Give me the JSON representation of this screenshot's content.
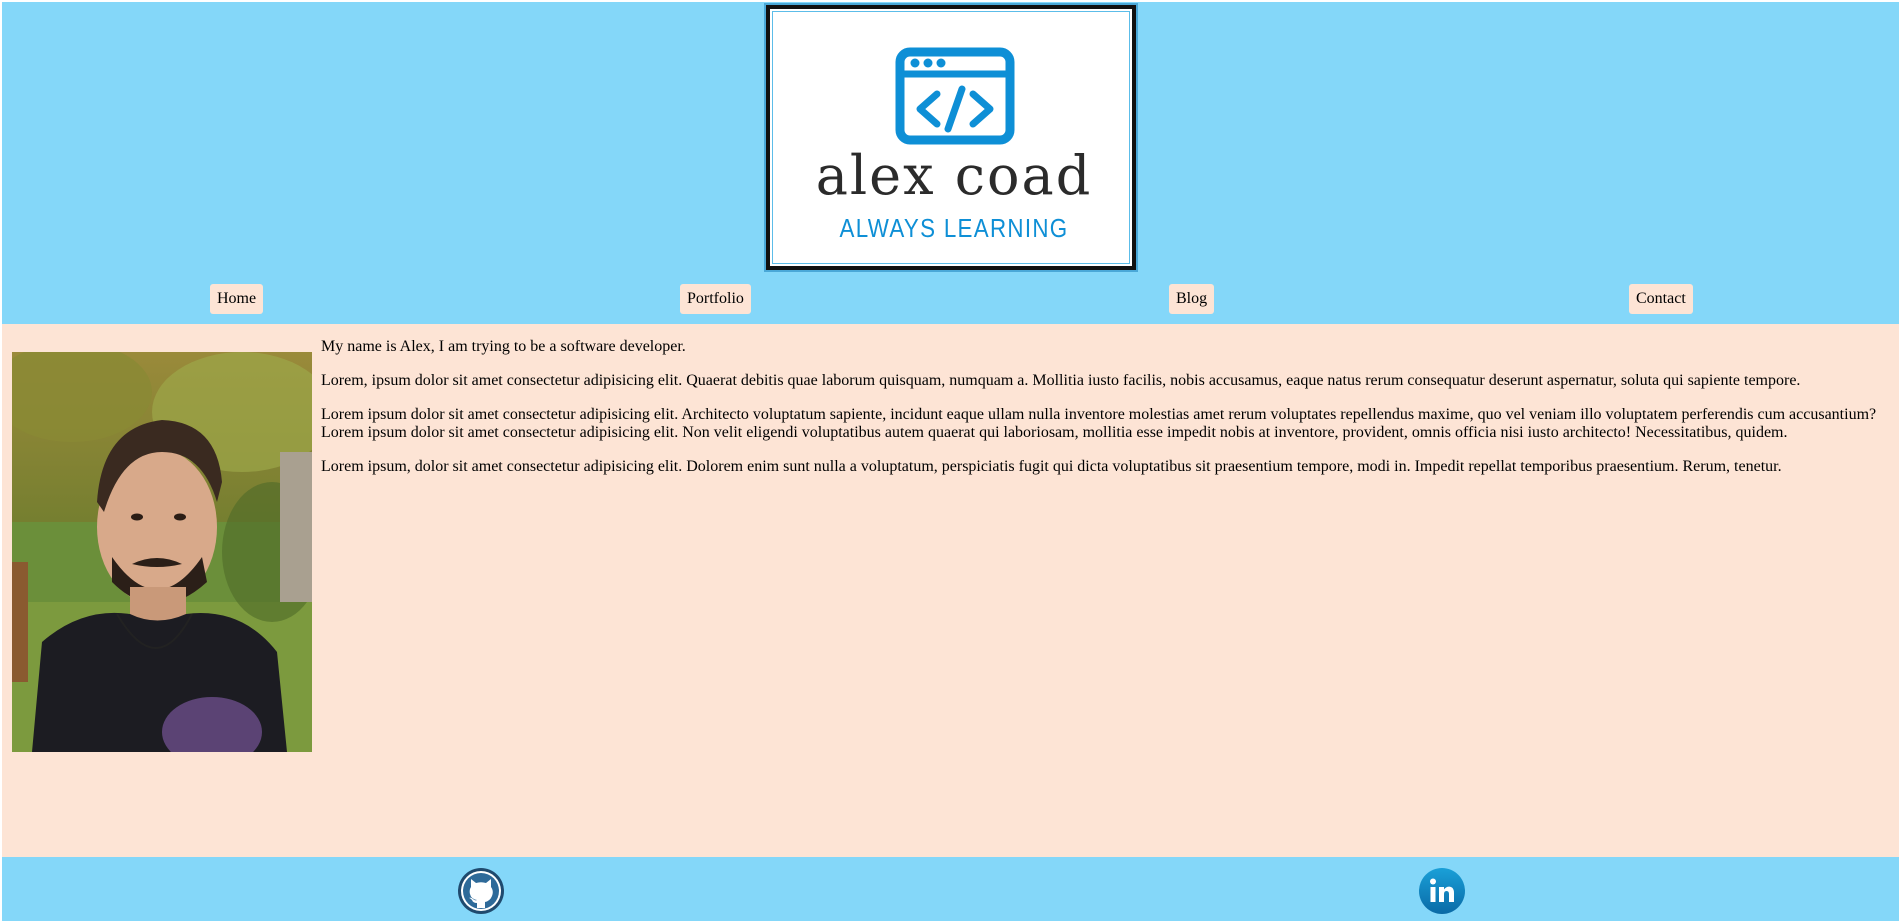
{
  "header": {
    "logo": {
      "name": "alex coad",
      "tagline": "ALWAYS LEARNING",
      "icon": "code-window-icon",
      "accent_color": "#0e8fd6"
    },
    "nav": [
      {
        "label": "Home"
      },
      {
        "label": "Portfolio"
      },
      {
        "label": "Blog"
      },
      {
        "label": "Contact"
      }
    ],
    "background_color": "#84d7f9"
  },
  "main": {
    "background_color": "#fde4d5",
    "portrait": "profile-photo",
    "paragraphs": [
      "My name is Alex, I am trying to be a software developer.",
      "Lorem, ipsum dolor sit amet consectetur adipisicing elit. Quaerat debitis quae laborum quisquam, numquam a. Mollitia iusto facilis, nobis accusamus, eaque natus rerum consequatur deserunt aspernatur, soluta qui sapiente tempore.",
      "Lorem ipsum dolor sit amet consectetur adipisicing elit. Architecto voluptatum sapiente, incidunt eaque ullam nulla inventore molestias amet rerum voluptates repellendus maxime, quo vel veniam illo voluptatem perferendis cum accusantium? Lorem ipsum dolor sit amet consectetur adipisicing elit. Non velit eligendi voluptatibus autem quaerat qui laboriosam, mollitia esse impedit nobis at inventore, provident, omnis officia nisi iusto architecto! Necessitatibus, quidem.",
      "Lorem ipsum, dolor sit amet consectetur adipisicing elit. Dolorem enim sunt nulla a voluptatum, perspiciatis fugit qui dicta voluptatibus sit praesentium tempore, modi in. Impedit repellat temporibus praesentium. Rerum, tenetur."
    ]
  },
  "footer": {
    "social": [
      {
        "icon": "github-icon"
      },
      {
        "icon": "linkedin-icon"
      }
    ]
  }
}
